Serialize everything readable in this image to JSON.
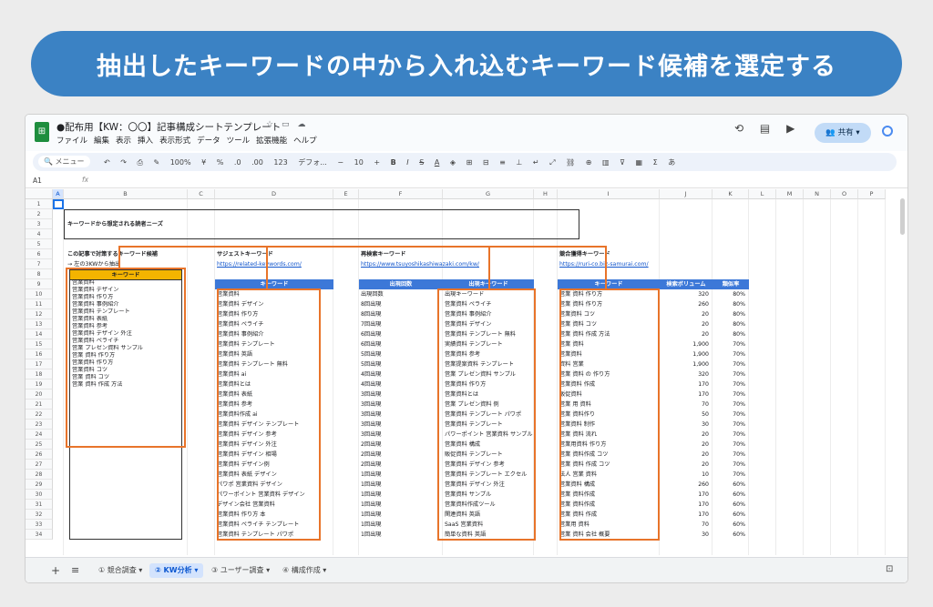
{
  "banner": "抽出したキーワードの中から入れ込むキーワード候補を選定する",
  "app": {
    "logo": "sheets-icon",
    "title": "●配布用【KW：〇〇】記事構成シートテンプレート",
    "menu": [
      "ファイル",
      "編集",
      "表示",
      "挿入",
      "表示形式",
      "データ",
      "ツール",
      "拡張機能",
      "ヘルプ"
    ],
    "share_label": "共有",
    "toolbar": {
      "menu_search": "メニュー",
      "zoom": "100%",
      "currency": "¥",
      "percent": "%",
      "font": "デフォ...",
      "font_size": "10"
    },
    "cell_ref": "A1",
    "fx": "fx"
  },
  "columns": [
    "A",
    "B",
    "C",
    "D",
    "E",
    "F",
    "G",
    "H",
    "I",
    "J",
    "K",
    "L",
    "M",
    "N",
    "O",
    "P"
  ],
  "rows": [
    "1",
    "2",
    "3",
    "4",
    "5",
    "6",
    "7",
    "8",
    "9",
    "10",
    "11",
    "12",
    "13",
    "14",
    "15",
    "16",
    "17",
    "18",
    "19",
    "20",
    "21",
    "22",
    "23",
    "24",
    "25",
    "26",
    "27",
    "28",
    "29",
    "30",
    "31",
    "32",
    "33",
    "34"
  ],
  "sheet": {
    "needs_title": "キーワードから想定される読者ニーズ",
    "target_title": "この記事で対策するキーワード候補",
    "target_note": "→ 左の3KWから抽出",
    "target_header": "キーワード",
    "target_keywords": [
      "営業資料",
      "営業資料 デザイン",
      "営業資料 作り方",
      "営業資料 事例紹介",
      "営業資料 テンプレート",
      "営業資料 表紙",
      "営業資料 参考",
      "営業資料 デザイン 外注",
      "営業資料 ペライチ",
      "営業 プレゼン資料 サンプル",
      "営業 資料 作り方",
      "営業資料 作り方",
      "営業資料 コツ",
      "営業 資料 コツ",
      "営業 資料 作成 方法"
    ],
    "suggest_title": "サジェストキーワード",
    "suggest_link": "https://related-keywords.com/",
    "suggest_header": "キーワード",
    "suggest_keywords": [
      "営業資料",
      "営業資料 デザイン",
      "営業資料 作り方",
      "営業資料 ペライチ",
      "営業資料 事例紹介",
      "営業資料 テンプレート",
      "営業資料 英語",
      "営業資料 テンプレート 無料",
      "営業資料 ai",
      "営業資料とは",
      "営業資料 表紙",
      "営業資料 参考",
      "営業資料作成 ai",
      "営業資料 デザイン テンプレート",
      "営業資料 デザイン 参考",
      "営業資料 デザイン 外注",
      "営業資料 デザイン 相場",
      "営業資料 デザイン例",
      "営業資料 表紙 デザイン",
      "パワポ 営業資料 デザイン",
      "パワーポイント 営業資料 デザイン",
      "デザイン会社 営業資料",
      "営業資料 作り方 本",
      "営業資料 ペライチ テンプレート",
      "営業資料 テンプレート パワポ"
    ],
    "research_title": "再検索キーワード",
    "research_link": "https://www.tsuyoshikashiwazaki.com/kw/",
    "count_header": "出現回数",
    "keyword_header": "出現キーワード",
    "research_counts": [
      "出現回数",
      "8回出現",
      "8回出現",
      "7回出現",
      "6回出現",
      "6回出現",
      "5回出現",
      "5回出現",
      "4回出現",
      "4回出現",
      "3回出現",
      "3回出現",
      "3回出現",
      "3回出現",
      "3回出現",
      "2回出現",
      "2回出現",
      "2回出現",
      "1回出現",
      "1回出現",
      "1回出現",
      "1回出現",
      "1回出現",
      "1回出現",
      "1回出現"
    ],
    "research_keywords": [
      "出現キーワード",
      "営業資料 ペライチ",
      "営業資料 事例紹介",
      "営業資料 デザイン",
      "営業資料 テンプレート 無料",
      "実績資料 テンプレート",
      "営業資料 参考",
      "営業提案資料 テンプレート",
      "営業 プレゼン資料 サンプル",
      "営業資料 作り方",
      "営業資料とは",
      "営業 プレゼン資料 例",
      "営業資料 テンプレート パワポ",
      "営業資料 テンプレート",
      "パワーポイント 営業資料 サンプル",
      "営業資料 構成",
      "販促資料 テンプレート",
      "営業資料 デザイン 参考",
      "営業資料 テンプレート エクセル",
      "営業資料 デザイン 外注",
      "営業資料 サンプル",
      "営業資料作成ツール",
      "関連資料 英語",
      "SaaS 営業資料",
      "簡単な資料 英語"
    ],
    "competitor_title": "競合獲得キーワード",
    "competitor_link": "https://ruri-co.biz-samurai.com/",
    "competitor_header": "キーワード",
    "volume_header": "検索ボリューム",
    "similarity_header": "類似率",
    "competitor_rows": [
      {
        "kw": "営業 資料 作り方",
        "vol": "320",
        "sim": "80%"
      },
      {
        "kw": "営業 資料 作り方",
        "vol": "260",
        "sim": "80%"
      },
      {
        "kw": "営業資料 コツ",
        "vol": "20",
        "sim": "80%"
      },
      {
        "kw": "営業 資料 コツ",
        "vol": "20",
        "sim": "80%"
      },
      {
        "kw": "営業 資料 作成 方法",
        "vol": "20",
        "sim": "80%"
      },
      {
        "kw": "営業 資料",
        "vol": "1,900",
        "sim": "70%"
      },
      {
        "kw": "営業資料",
        "vol": "1,900",
        "sim": "70%"
      },
      {
        "kw": "資料 営業",
        "vol": "1,900",
        "sim": "70%"
      },
      {
        "kw": "営業 資料 の 作り方",
        "vol": "320",
        "sim": "70%"
      },
      {
        "kw": "営業資料 作成",
        "vol": "170",
        "sim": "70%"
      },
      {
        "kw": "販促資料",
        "vol": "170",
        "sim": "70%"
      },
      {
        "kw": "営業 用 資料",
        "vol": "70",
        "sim": "70%"
      },
      {
        "kw": "営業 資料作り",
        "vol": "50",
        "sim": "70%"
      },
      {
        "kw": "営業資料 制作",
        "vol": "30",
        "sim": "70%"
      },
      {
        "kw": "営業 資料 流れ",
        "vol": "20",
        "sim": "70%"
      },
      {
        "kw": "営業用資料 作り方",
        "vol": "20",
        "sim": "70%"
      },
      {
        "kw": "営業 資料作成 コツ",
        "vol": "20",
        "sim": "70%"
      },
      {
        "kw": "営業 資料 作成 コツ",
        "vol": "20",
        "sim": "70%"
      },
      {
        "kw": "法人 営業 資料",
        "vol": "10",
        "sim": "70%"
      },
      {
        "kw": "営業資料 構成",
        "vol": "260",
        "sim": "60%"
      },
      {
        "kw": "営業 資料作成",
        "vol": "170",
        "sim": "60%"
      },
      {
        "kw": "営業 資料作成",
        "vol": "170",
        "sim": "60%"
      },
      {
        "kw": "営業 資料 作成",
        "vol": "170",
        "sim": "60%"
      },
      {
        "kw": "営業用 資料",
        "vol": "70",
        "sim": "60%"
      },
      {
        "kw": "営業 資料 会社 概要",
        "vol": "30",
        "sim": "60%"
      }
    ]
  },
  "tabs": [
    "① 競合調査",
    "② KW分析",
    "③ ユーザー調査",
    "④ 構成作成"
  ],
  "active_tab": 1
}
